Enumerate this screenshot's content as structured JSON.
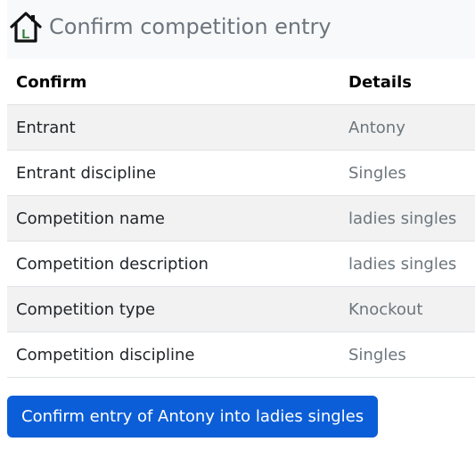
{
  "header": {
    "title": "Confirm competition entry",
    "logo_letter": "L",
    "logo_icon": "house-icon"
  },
  "table": {
    "columns": [
      "Confirm",
      "Details"
    ],
    "rows": [
      {
        "label": "Entrant",
        "value": "Antony"
      },
      {
        "label": "Entrant discipline",
        "value": "Singles"
      },
      {
        "label": "Competition name",
        "value": "ladies singles"
      },
      {
        "label": "Competition description",
        "value": "ladies singles"
      },
      {
        "label": "Competition type",
        "value": "Knockout"
      },
      {
        "label": "Competition discipline",
        "value": "Singles"
      }
    ]
  },
  "actions": {
    "confirm_label": "Confirm entry of Antony into ladies singles"
  },
  "colors": {
    "header_bg": "#f8f9fa",
    "title_text": "#6c757d",
    "striped_row": "#f2f2f2",
    "primary_button": "#0b5ed7",
    "logo_green": "#2e7d32"
  }
}
